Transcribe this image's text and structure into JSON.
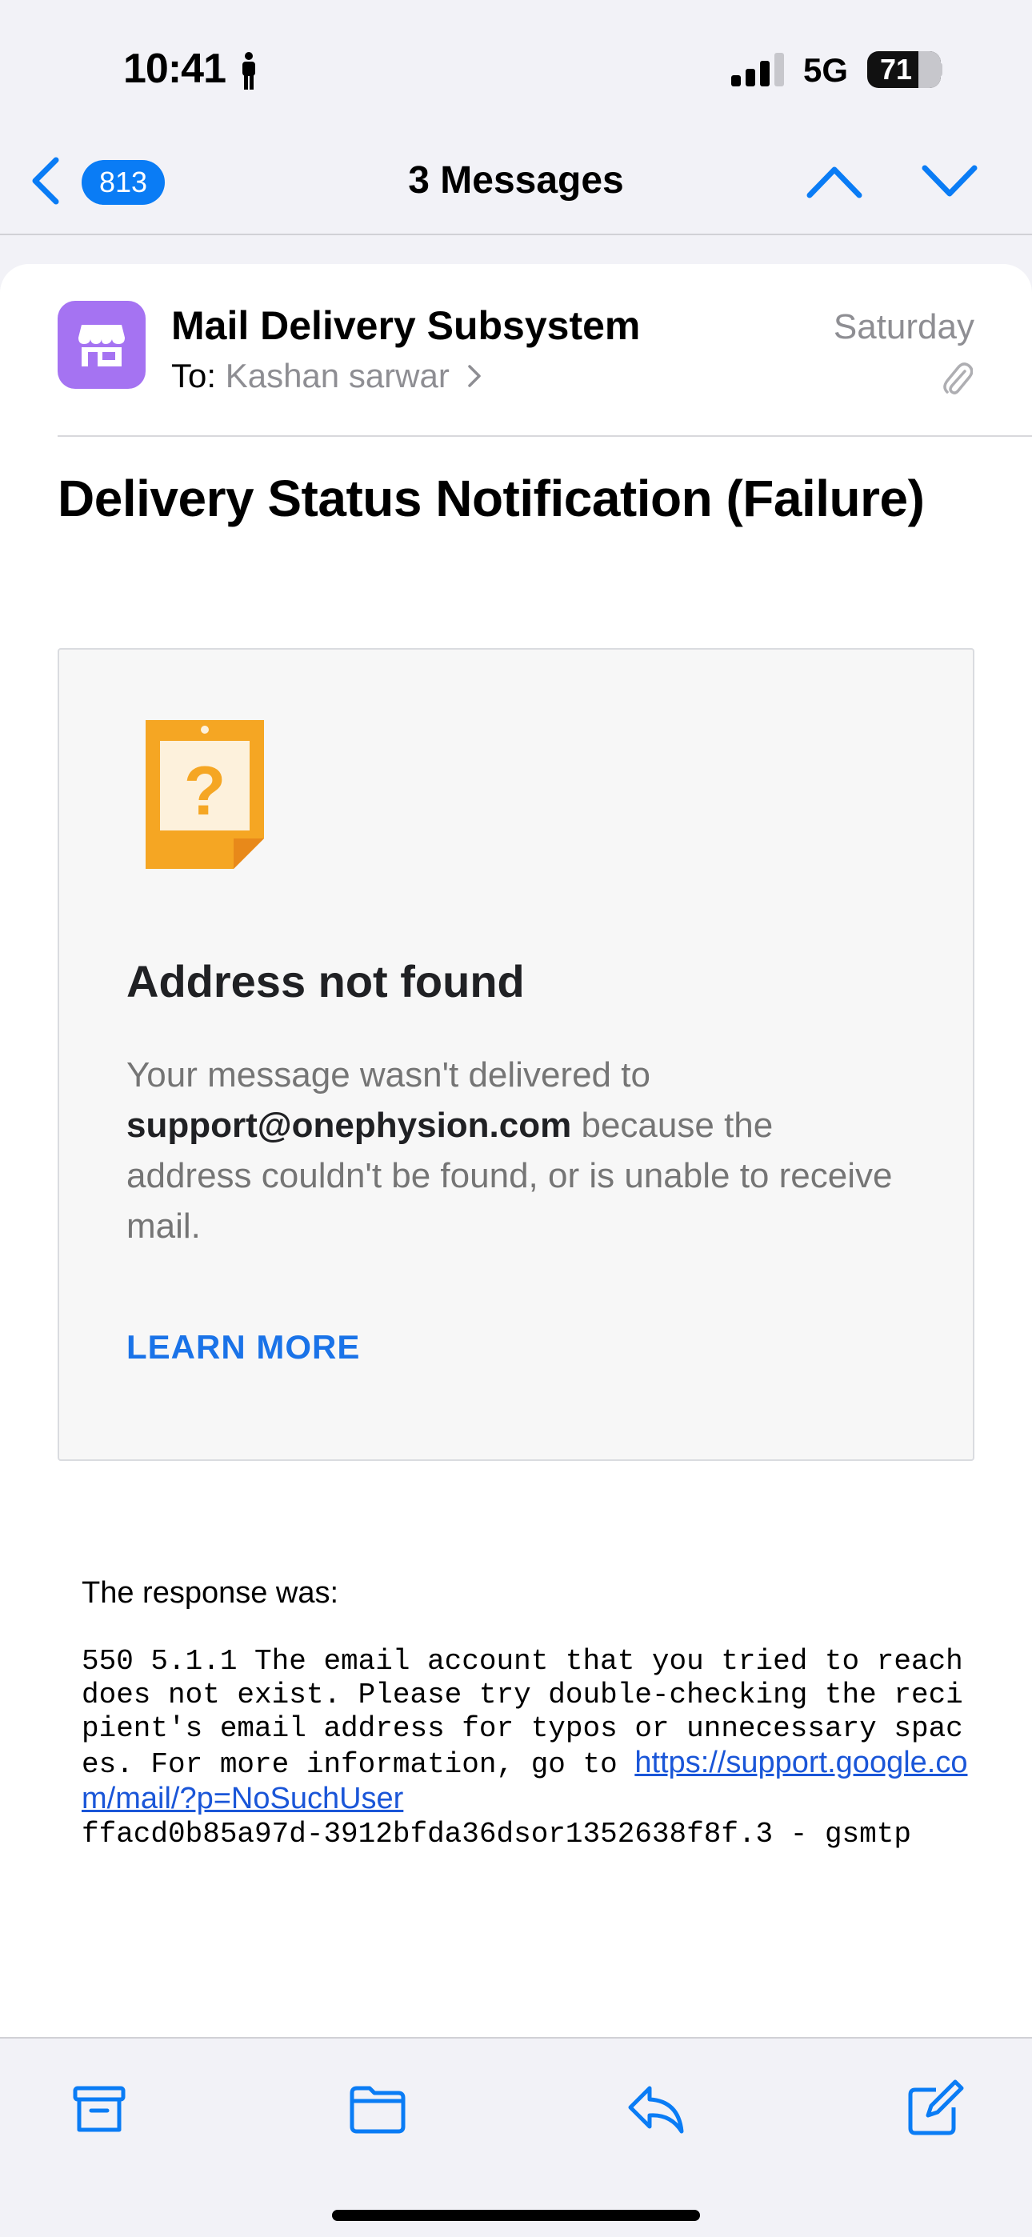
{
  "status_bar": {
    "time": "10:41",
    "network": "5G",
    "battery": "71",
    "battery_level": 0.71
  },
  "nav": {
    "unread_count": "813",
    "title": "3 Messages"
  },
  "message": {
    "sender": "Mail Delivery Subsystem",
    "to_label": "To:",
    "recipient": "Kashan sarwar",
    "date": "Saturday",
    "subject": "Delivery Status Notification (Failure)"
  },
  "notice": {
    "heading": "Address not found",
    "body_prefix": "Your message wasn't delivered to ",
    "address": "support@onephysion.com",
    "body_suffix": " because the address couldn't be found, or is unable to receive mail.",
    "learn_more": "LEARN MORE"
  },
  "response": {
    "label": "The response was:",
    "text": "550 5.1.1 The email account that you tried to reach does not exist. Please try double-checking the recipient's email address for typos or unnecessary spaces. For more information, go to ",
    "link": "https://support.google.com/mail/?p=NoSuchUser",
    "trailer": "ffacd0b85a97d-3912bfda36dsor1352638f8f.3 - gsmtp"
  },
  "colors": {
    "accent": "#0a7cf5",
    "avatar": "#a573f2",
    "icon_orange": "#f5a623"
  }
}
